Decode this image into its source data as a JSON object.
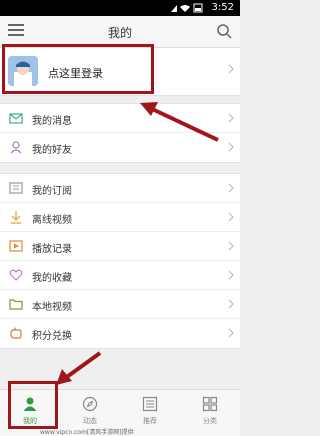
{
  "status": {
    "time": "3:52"
  },
  "header": {
    "title": "我的"
  },
  "login": {
    "text": "点这里登录"
  },
  "menu": {
    "group1": [
      {
        "label": "我的消息",
        "icon": "mail-icon"
      },
      {
        "label": "我的好友",
        "icon": "person-icon"
      }
    ],
    "group2": [
      {
        "label": "我的订阅",
        "icon": "subscribe-icon"
      },
      {
        "label": "离线视频",
        "icon": "download-icon"
      },
      {
        "label": "播放记录",
        "icon": "play-icon"
      },
      {
        "label": "我的收藏",
        "icon": "heart-icon"
      },
      {
        "label": "本地视频",
        "icon": "folder-icon"
      },
      {
        "label": "积分兑换",
        "icon": "hand-icon"
      }
    ]
  },
  "tabs": [
    {
      "label": "我的",
      "active": true
    },
    {
      "label": "动态",
      "active": false
    },
    {
      "label": "推荐",
      "active": false
    },
    {
      "label": "分类",
      "active": false
    }
  ],
  "watermark": "www.vipcn.com[清风手游网]提供",
  "colors": {
    "accent_green": "#2e9b3f",
    "annotation_red": "#a0161a"
  }
}
